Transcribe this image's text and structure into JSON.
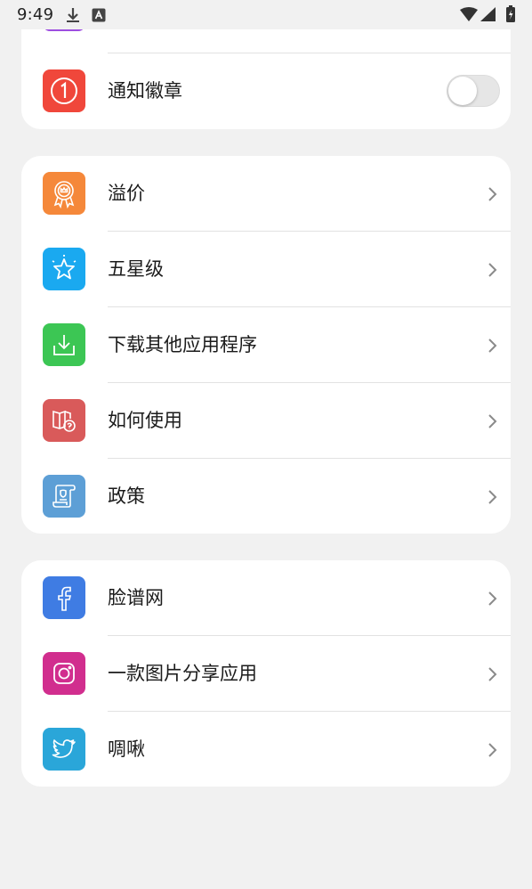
{
  "status_bar": {
    "time": "9:49"
  },
  "notifications_section": {
    "badge_label": "通知徽章",
    "badge_toggle_on": false
  },
  "menu_section": {
    "items": [
      {
        "label": "溢价",
        "icon": "premium-badge-icon",
        "color": "#f5883a"
      },
      {
        "label": "五星级",
        "icon": "star-icon",
        "color": "#1aa9f0"
      },
      {
        "label": "下载其他应用程序",
        "icon": "download-icon",
        "color": "#3cc654"
      },
      {
        "label": "如何使用",
        "icon": "help-book-icon",
        "color": "#d95a5a"
      },
      {
        "label": "政策",
        "icon": "policy-scroll-icon",
        "color": "#5d9fd6"
      }
    ]
  },
  "social_section": {
    "items": [
      {
        "label": "脸谱网",
        "icon": "facebook-icon",
        "color": "#3f7ce3"
      },
      {
        "label": "一款图片分享应用",
        "icon": "instagram-icon",
        "color": "#d12e8e"
      },
      {
        "label": "啁啾",
        "icon": "twitter-icon",
        "color": "#2aa6d9"
      }
    ]
  },
  "colors": {
    "background": "#f1f1f1",
    "card": "#ffffff",
    "badge_icon": "#f0473b",
    "top_partial_icon": "#9d4ee0"
  }
}
